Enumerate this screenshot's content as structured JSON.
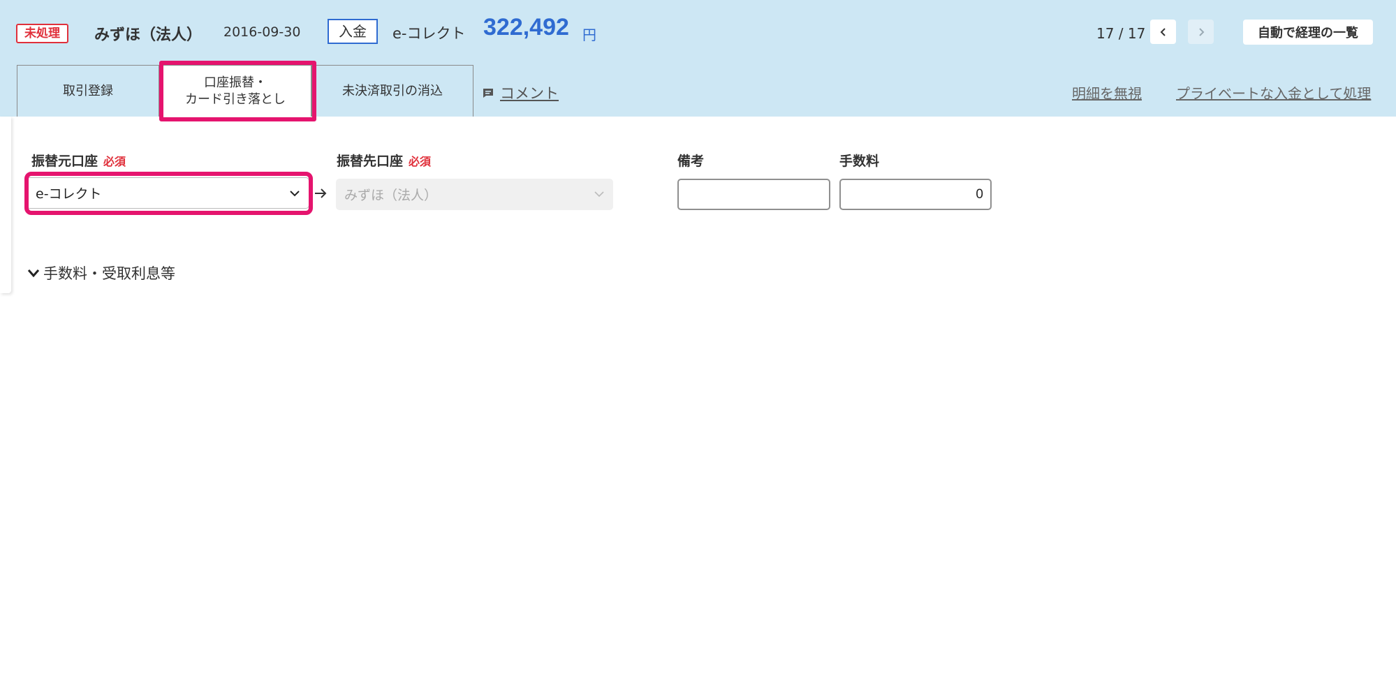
{
  "header": {
    "status": "未処理",
    "bank_name": "みずほ（法人）",
    "date": "2016-09-30",
    "type": "入金",
    "partner": "e-コレクト",
    "amount": "322,492",
    "currency": "円",
    "pager": "17 / 17",
    "list_button": "自動で経理の一覧"
  },
  "tabs": {
    "trade": "取引登録",
    "transfer_line1": "口座振替・",
    "transfer_line2": "カード引き落とし",
    "clear": "未決済取引の消込",
    "comment": "コメント",
    "ignore": "明細を無視",
    "private": "プライベートな入金として処理"
  },
  "form": {
    "from_label": "振替元口座",
    "to_label": "振替先口座",
    "required": "必須",
    "from_value": "e-コレクト",
    "to_value": "みずほ（法人）",
    "memo_label": "備考",
    "memo_value": "",
    "fee_label": "手数料",
    "fee_value": "0",
    "expander": "手数料・受取利息等"
  },
  "colors": {
    "header_bg": "#cde7f4",
    "accent": "#2f6bd1",
    "alert": "#e0303b",
    "highlight": "#e5146e"
  },
  "icons": {
    "prev": "chevron-left-icon",
    "next": "chevron-right-icon",
    "comment": "comment-icon",
    "arrow": "arrow-right-icon",
    "dropdown": "chevron-down-icon"
  }
}
